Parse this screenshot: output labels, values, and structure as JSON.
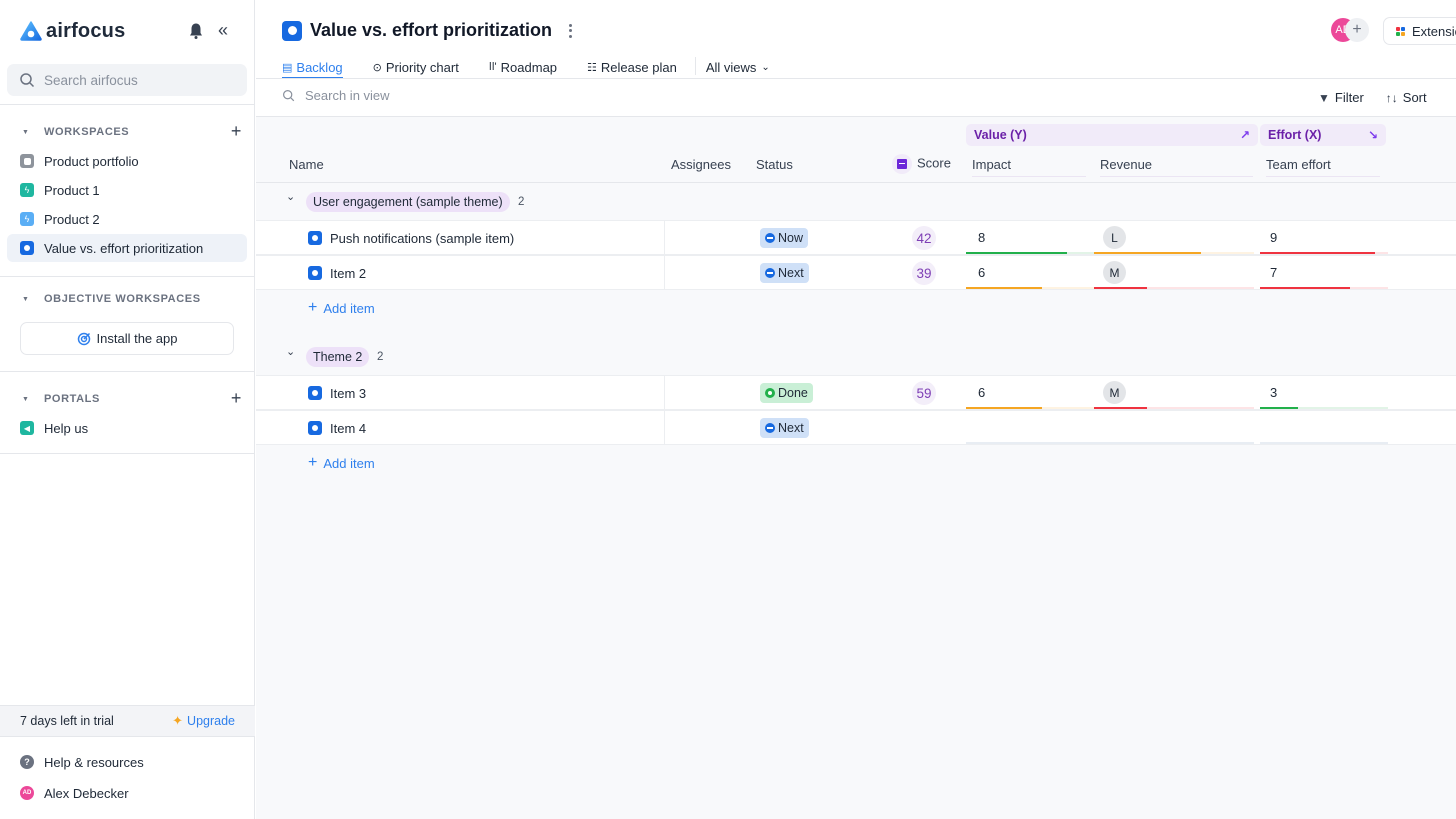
{
  "app": {
    "logo_text": "airfocus",
    "search_placeholder": "Search airfocus"
  },
  "sidebar": {
    "workspaces_label": "WORKSPACES",
    "workspaces": [
      {
        "label": "Product portfolio",
        "color": "#8e949c",
        "icon": "portfolio-icon"
      },
      {
        "label": "Product 1",
        "color": "#1fb7a0",
        "icon": "bolt-icon"
      },
      {
        "label": "Product 2",
        "color": "#5aaef5",
        "icon": "bolt-icon"
      },
      {
        "label": "Value vs. effort prioritization",
        "color": "#1769e0",
        "icon": "circle-icon",
        "active": true
      }
    ],
    "objective_label": "OBJECTIVE WORKSPACES",
    "install_label": "Install the app",
    "portals_label": "PORTALS",
    "portals": [
      {
        "label": "Help us",
        "color": "#1fb7a0",
        "icon": "megaphone-icon"
      }
    ],
    "trial_text": "7 days left in trial",
    "upgrade_label": "Upgrade",
    "help_label": "Help & resources",
    "user_name": "Alex Debecker",
    "user_initials": "AD"
  },
  "header": {
    "title": "Value vs. effort prioritization",
    "avatar_initials": "AD",
    "extensions_label": "Extensions",
    "tabs": [
      {
        "label": "Backlog",
        "icon": "backlog-icon",
        "active": true
      },
      {
        "label": "Priority chart",
        "icon": "target-icon"
      },
      {
        "label": "Roadmap",
        "icon": "roadmap-icon"
      },
      {
        "label": "Release plan",
        "icon": "release-plan-icon"
      }
    ],
    "all_views_label": "All views",
    "view_search_placeholder": "Search in view",
    "filter_label": "Filter",
    "sort_label": "Sort"
  },
  "table": {
    "groups": {
      "value_label": "Value (Y)",
      "effort_label": "Effort (X)"
    },
    "columns": {
      "name": "Name",
      "assignees": "Assignees",
      "status": "Status",
      "score": "Score",
      "impact": "Impact",
      "revenue": "Revenue",
      "team_effort": "Team effort"
    },
    "add_item_label": "Add item",
    "themes": [
      {
        "name": "User engagement (sample theme)",
        "count": "2",
        "items": [
          {
            "name": "Push notifications (sample item)",
            "status": "Now",
            "score": "42",
            "impact": "8",
            "impact_frac": 0.8,
            "impact_color": "#22b04b",
            "revenue": "L",
            "revenue_frac": 0.67,
            "revenue_color": "#f5a623",
            "effort": "9",
            "effort_frac": 0.9,
            "effort_color": "#ef3340"
          },
          {
            "name": "Item 2",
            "status": "Next",
            "score": "39",
            "impact": "6",
            "impact_frac": 0.6,
            "impact_color": "#f5a623",
            "revenue": "M",
            "revenue_frac": 0.33,
            "revenue_color": "#ef3340",
            "effort": "7",
            "effort_frac": 0.7,
            "effort_color": "#ef3340"
          }
        ]
      },
      {
        "name": "Theme 2",
        "count": "2",
        "items": [
          {
            "name": "Item 3",
            "status": "Done",
            "score": "59",
            "impact": "6",
            "impact_frac": 0.6,
            "impact_color": "#f5a623",
            "revenue": "M",
            "revenue_frac": 0.33,
            "revenue_color": "#ef3340",
            "effort": "3",
            "effort_frac": 0.3,
            "effort_color": "#22b04b"
          },
          {
            "name": "Item 4",
            "status": "Next",
            "score": "",
            "impact": "",
            "revenue": "",
            "effort": ""
          }
        ]
      }
    ],
    "status_styles": {
      "Now": {
        "bg": "#cfe0f7",
        "icon": "#1769e0"
      },
      "Next": {
        "bg": "#cfe0f7",
        "icon": "#1769e0"
      },
      "Done": {
        "bg": "#c9efd6",
        "icon": "#22b04b"
      }
    }
  }
}
